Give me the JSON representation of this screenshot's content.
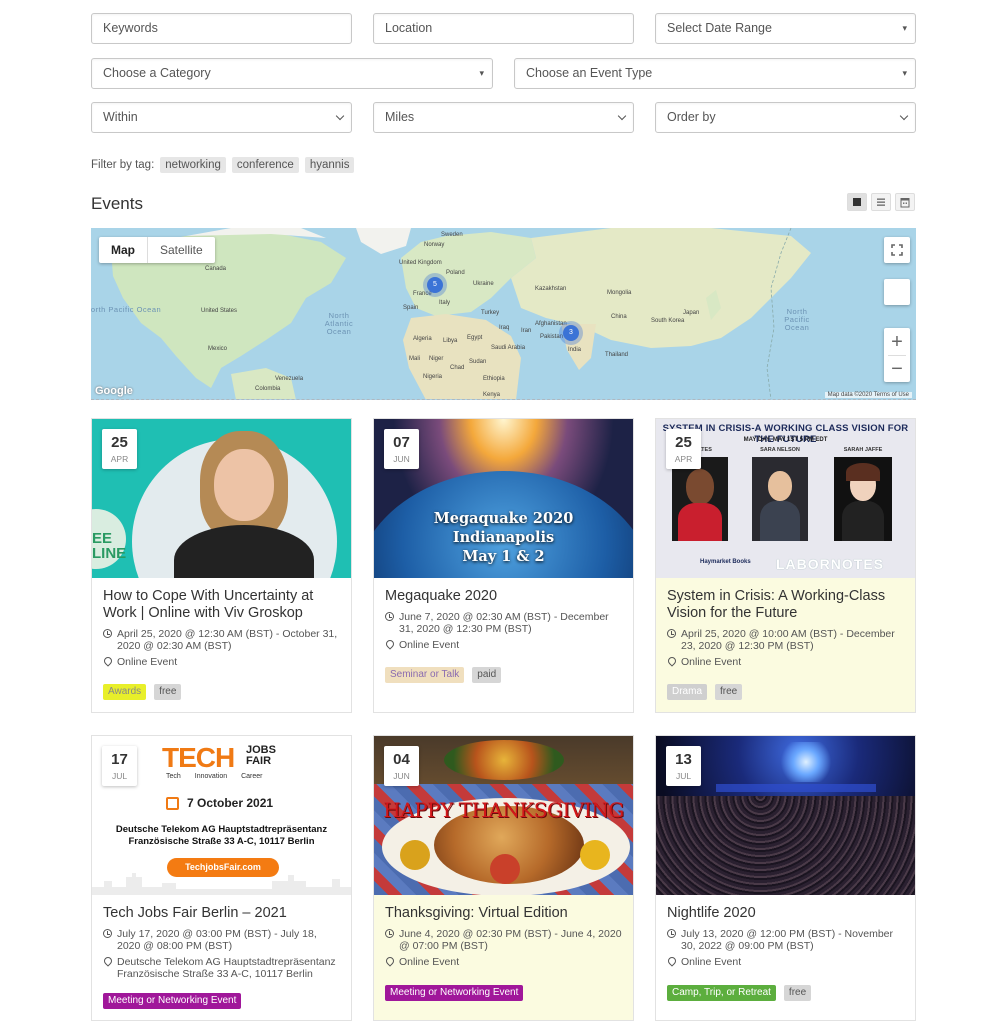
{
  "filters": {
    "keywords_placeholder": "Keywords",
    "location_placeholder": "Location",
    "date_range": "Select Date Range",
    "category": "Choose a Category",
    "event_type": "Choose an Event Type",
    "within": "Within",
    "miles": "Miles",
    "order_by": "Order by"
  },
  "tag_filter": {
    "label": "Filter by tag:",
    "tags": [
      "networking",
      "conference",
      "hyannis"
    ]
  },
  "section_title": "Events",
  "map": {
    "type_map": "Map",
    "type_satellite": "Satellite",
    "google": "Google",
    "attribution": "Map data ©2020   Terms of Use",
    "zoom_in": "+",
    "zoom_out": "−",
    "oceans": [
      "North Pacific Ocean",
      "North Atlantic Ocean",
      "North Pacific Ocean"
    ],
    "clusters": [
      "5",
      "3"
    ],
    "places": [
      "Canada",
      "United States",
      "Mexico",
      "Venezuela",
      "Colombia",
      "Sweden",
      "Norway",
      "United Kingdom",
      "Poland",
      "Ukraine",
      "France",
      "Italy",
      "Spain",
      "Turkey",
      "Kazakhstan",
      "Mongolia",
      "China",
      "Japan",
      "South Korea",
      "Iraq",
      "Iran",
      "Afghanistan",
      "Pakistan",
      "India",
      "Thailand",
      "Algeria",
      "Libya",
      "Egypt",
      "Saudi Arabia",
      "Mali",
      "Niger",
      "Chad",
      "Sudan",
      "Nigeria",
      "Ethiopia",
      "Kenya"
    ]
  },
  "events": [
    {
      "day": "25",
      "month": "APR",
      "title": "How to Cope With Uncertainty at Work | Online with Viv Groskop",
      "when": "April 25, 2020 @ 12:30 AM (BST) - October 31, 2020 @ 02:30 AM (BST)",
      "where": "Online Event",
      "badges": [
        {
          "text": "Awards",
          "color": "#e8ef2a",
          "fg": "#888"
        },
        {
          "text": "free",
          "color": "#d6d6d6",
          "fg": "#555"
        }
      ],
      "image": {
        "overlay": "EE LINE"
      }
    },
    {
      "day": "07",
      "month": "JUN",
      "title": "Megaquake 2020",
      "when": "June 7, 2020 @ 02:30 AM (BST) - December 31, 2020 @ 12:30 PM (BST)",
      "where": "Online Event",
      "badges": [
        {
          "text": "Seminar or Talk",
          "color": "#f0dfbe",
          "fg": "#8a6bb0"
        },
        {
          "text": "paid",
          "color": "#d6d6d6",
          "fg": "#555"
        }
      ],
      "image": {
        "line1": "Megaquake 2020",
        "line2": "Indianapolis",
        "line3": "May 1 & 2"
      }
    },
    {
      "day": "25",
      "month": "APR",
      "title": "System in Crisis: A Working-Class Vision for the Future",
      "when": "April 25, 2020 @ 10:00 AM (BST) - December 23, 2020 @ 12:30 PM (BST)",
      "where": "Online Event",
      "badges": [
        {
          "text": "Drama",
          "color": "#cfcfcf",
          "fg": "#fff"
        },
        {
          "text": "free",
          "color": "#d6d6d6",
          "fg": "#555"
        }
      ],
      "image": {
        "headline": "SYSTEM IN CRISIS-A WORKING CLASS VISION FOR THE FUTURE",
        "sub": "MAY DAY, MAY 1ST 5 PM EDT",
        "names": [
          "S GATES",
          "SARA NELSON",
          "SARAH JAFFE"
        ],
        "publisher": "Haymarket Books",
        "brand": "LABORNOTES"
      }
    },
    {
      "day": "17",
      "month": "JUL",
      "title": "Tech Jobs Fair Berlin – 2021",
      "when": "July 17, 2020 @ 03:00 PM (BST) - July 18, 2020 @ 08:00 PM (BST)",
      "where": "Deutsche Telekom AG Hauptstadtrepräsentanz Französische Straße 33 A-C, 10117 Berlin",
      "badges": [
        {
          "text": "Meeting or Networking Event",
          "color": "#a0179a",
          "fg": "#fff"
        }
      ],
      "image": {
        "logo": "TECH",
        "logo2": "JOBS FAIR",
        "tagline": [
          "Tech",
          "Innovation",
          "Career"
        ],
        "date": "7 October 2021",
        "venue": "Deutsche Telekom AG Hauptstadtrepräsentanz",
        "address": "Französische Straße 33 A-C, 10117 Berlin",
        "url": "TechjobsFair.com"
      }
    },
    {
      "day": "04",
      "month": "JUN",
      "title": "Thanksgiving: Virtual Edition",
      "when": "June 4, 2020 @ 02:30 PM (BST) - June 4, 2020 @ 07:00 PM (BST)",
      "where": "Online Event",
      "badges": [
        {
          "text": "Meeting or Networking Event",
          "color": "#a0179a",
          "fg": "#fff"
        }
      ],
      "image": {
        "text": "HAPPY THANKSGIVING"
      }
    },
    {
      "day": "13",
      "month": "JUL",
      "title": "Nightlife 2020",
      "when": "July 13, 2020 @ 12:00 PM (BST) - November 30, 2022 @ 09:00 PM (BST)",
      "where": "Online Event",
      "badges": [
        {
          "text": "Camp, Trip, or Retreat",
          "color": "#5cae3e",
          "fg": "#fff"
        },
        {
          "text": "free",
          "color": "#d6d6d6",
          "fg": "#555"
        }
      ],
      "image": {}
    }
  ]
}
